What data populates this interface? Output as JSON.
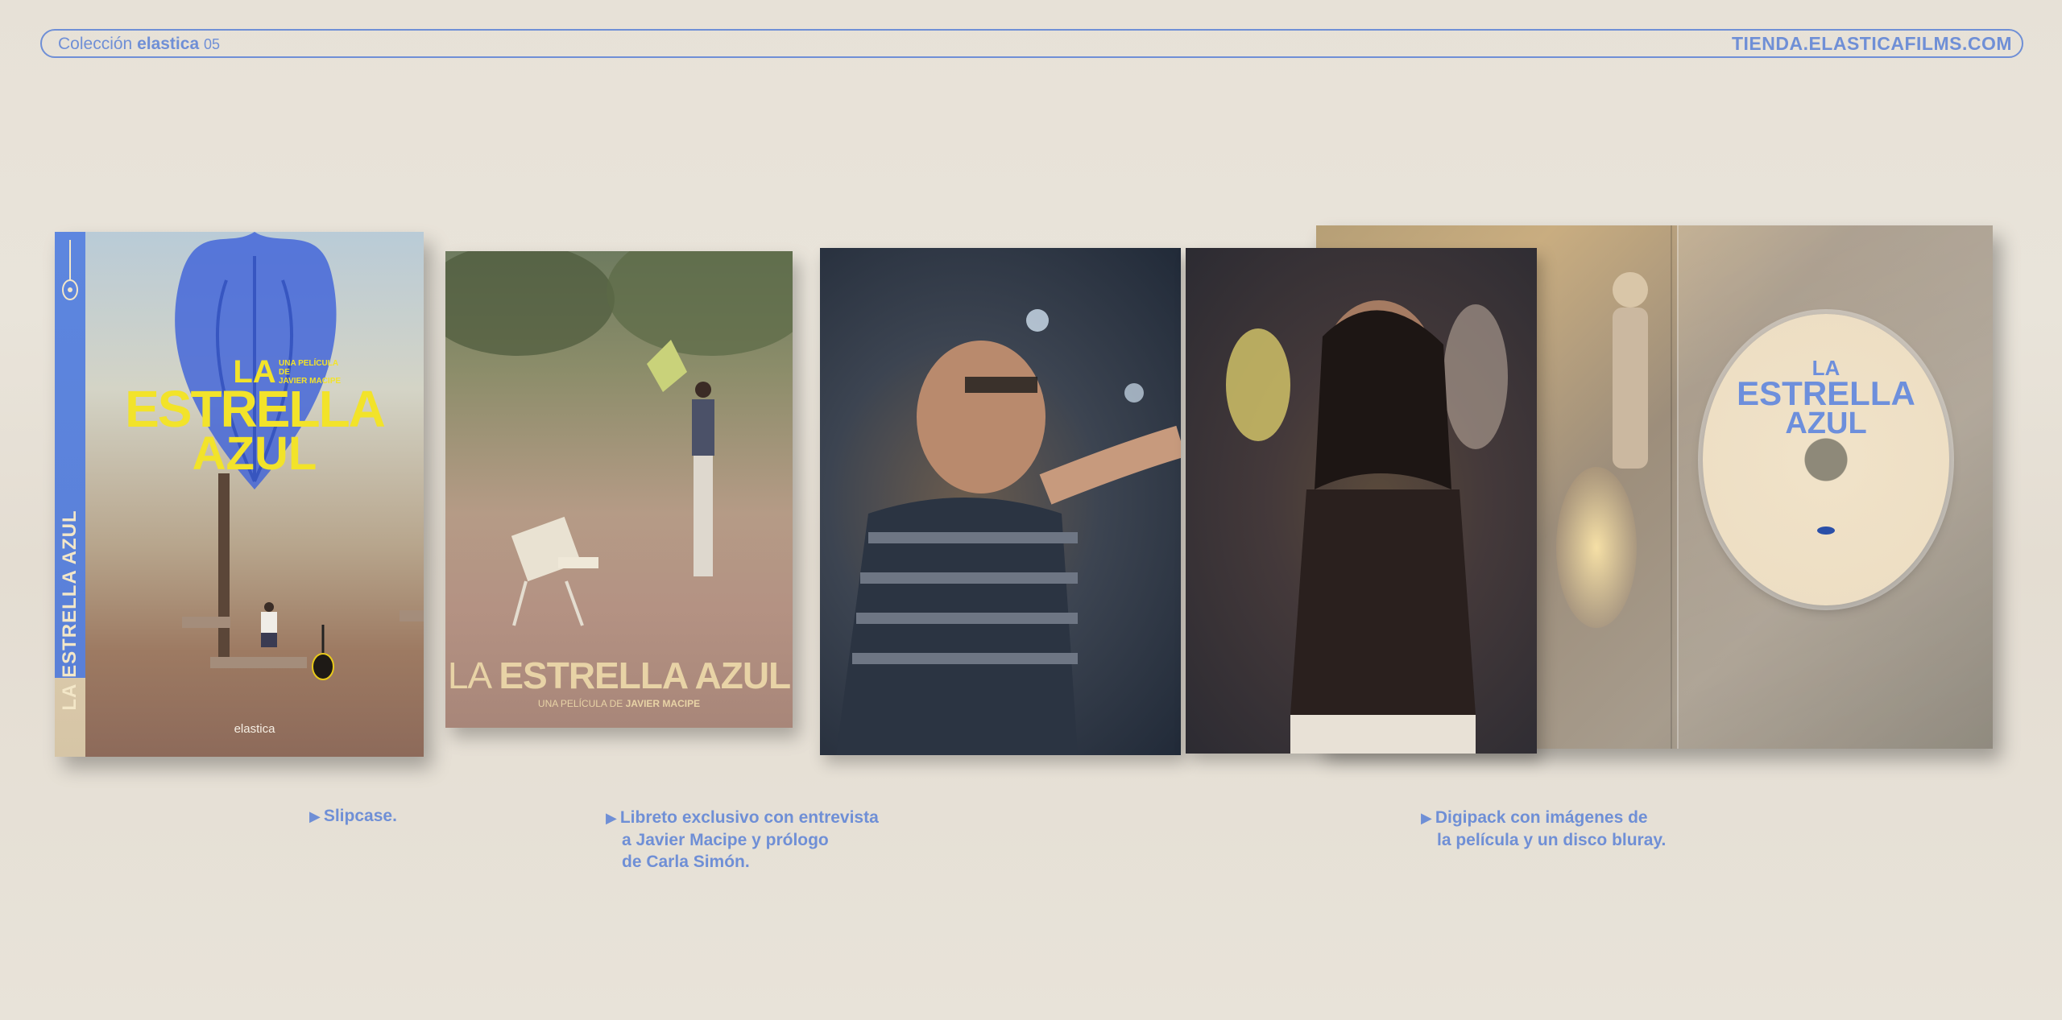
{
  "header": {
    "collection_prefix": "Colección",
    "collection_brand": "elastica",
    "collection_number": "05",
    "shop_url": "TIENDA.ELASTICAFILMS.COM"
  },
  "slipcase": {
    "spine_title": "LA ESTRELLA AZUL",
    "title_line1": "LA",
    "title_line2": "ESTRELLA",
    "title_line3": "AZUL",
    "credit_line1": "UNA PELÍCULA DE",
    "credit_line2": "JAVIER MACIPE",
    "logo": "elastica"
  },
  "booklet": {
    "title_la": "LA ",
    "title_rest": "ESTRELLA AZUL",
    "credit_prefix": "UNA PELÍCULA DE ",
    "credit_name": "JAVIER MACIPE"
  },
  "disc": {
    "title_line1": "LA",
    "title_line2": "ESTRELLA",
    "title_line3": "AZUL"
  },
  "captions": {
    "slipcase": {
      "arrow": "▶",
      "lines": [
        "Slipcase."
      ]
    },
    "booklet": {
      "arrow": "▶",
      "lines": [
        "Libreto exclusivo con entrevista",
        "a Javier Macipe y prólogo",
        "de Carla Simón."
      ]
    },
    "digipack": {
      "arrow": "▶",
      "lines": [
        "Digipack con imágenes de",
        "la película y un disco bluray."
      ]
    }
  },
  "colors": {
    "accent": "#6f8fd6",
    "background": "#e8e3d9",
    "title_yellow": "#f2e32a",
    "spine_blue": "#5d86df"
  }
}
